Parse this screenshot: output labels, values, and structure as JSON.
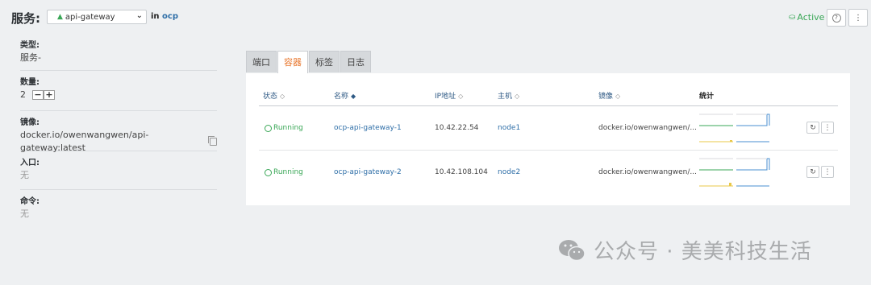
{
  "header": {
    "title": "服务:",
    "service_select": "api-gateway",
    "in_label": "in",
    "namespace": "ocp",
    "state": "Active",
    "help_glyph": "?",
    "more_glyph": "⋮"
  },
  "details": {
    "type_label": "类型:",
    "type_value": "服务-",
    "count_label": "数量:",
    "count_value": "2",
    "scale_down": "−",
    "scale_up": "+",
    "image_label": "镜像:",
    "image_value": "docker.io/owenwangwen/api-gateway:latest",
    "entry_label": "入口:",
    "entry_value": "无",
    "command_label": "命令:",
    "command_value": "无"
  },
  "tabs": [
    {
      "label": "端口"
    },
    {
      "label": "容器"
    },
    {
      "label": "标签"
    },
    {
      "label": "日志"
    }
  ],
  "active_tab": "容器",
  "table": {
    "headers": {
      "status": "状态",
      "name": "名称",
      "ip": "IP地址",
      "host": "主机",
      "image": "镜像",
      "stats": "统计"
    },
    "rows": [
      {
        "status": "Running",
        "name": "ocp-api-gateway-1",
        "ip": "10.42.22.54",
        "host": "node1",
        "image": "docker.io/owenwangwen/...",
        "refresh_glyph": "↻",
        "more_glyph": "⋮"
      },
      {
        "status": "Running",
        "name": "ocp-api-gateway-2",
        "ip": "10.42.108.104",
        "host": "node2",
        "image": "docker.io/owenwangwen/...",
        "refresh_glyph": "↻",
        "more_glyph": "⋮"
      }
    ]
  },
  "watermark": "公众号 · 美美科技生活",
  "colors": {
    "accent_green": "#3aa757",
    "link_blue": "#2f6fa8",
    "active_tab_orange": "#e8772e",
    "spark_yellow": "#e8c84a",
    "spark_blue": "#4a8fd0"
  }
}
